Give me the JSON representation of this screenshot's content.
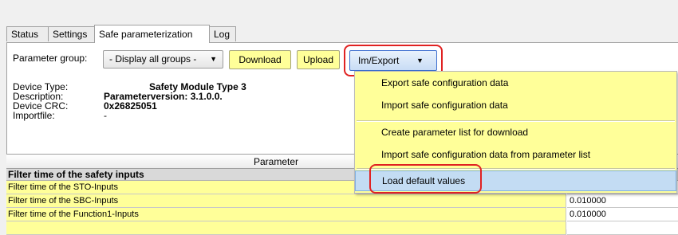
{
  "tabs": [
    {
      "label": "Status"
    },
    {
      "label": "Settings"
    },
    {
      "label": "Safe parameterization"
    },
    {
      "label": "Log"
    }
  ],
  "toolbar": {
    "param_group_label": "Parameter group:",
    "param_group_value": "- Display all groups -",
    "download_label": "Download",
    "upload_label": "Upload",
    "imexport_label": "Im/Export"
  },
  "device_info": [
    {
      "label": "Device Type:",
      "value": "Safety Module Type 3"
    },
    {
      "label": "Description:",
      "value": "Parameterversion: 3.1.0.0."
    },
    {
      "label": "Device CRC:",
      "value": "0x26825051"
    },
    {
      "label": "Importfile:",
      "value": "-"
    }
  ],
  "menu": {
    "items": [
      {
        "label": "Export safe configuration data"
      },
      {
        "label": "Import safe configuration data"
      },
      {
        "label": "Create parameter list for download"
      },
      {
        "label": "Import safe configuration data from parameter list"
      },
      {
        "label": "Load default values"
      }
    ]
  },
  "grid": {
    "header": "Parameter",
    "group_title": "Filter time of the safety inputs",
    "rows": [
      {
        "name": "Filter time of the STO-Inputs",
        "value": ""
      },
      {
        "name": "Filter time of the SBC-Inputs",
        "value": "0.010000"
      },
      {
        "name": "Filter time of the Function1-Inputs",
        "value": "0.010000"
      },
      {
        "name": "",
        "value": ""
      }
    ]
  },
  "colors": {
    "menu_bg": "#ffff99",
    "highlight": "#e02222",
    "accent": "#3d6fd0"
  }
}
